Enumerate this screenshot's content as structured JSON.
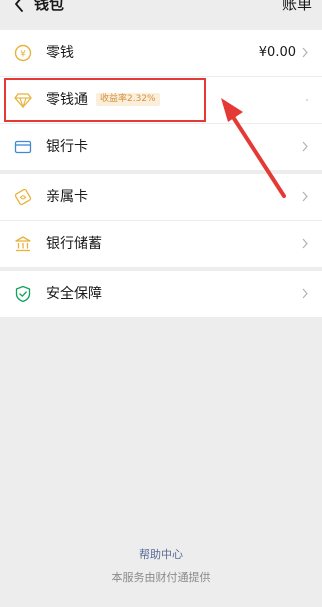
{
  "header": {
    "title": "钱包",
    "bill_label": "账单"
  },
  "groups": [
    {
      "rows": [
        {
          "label": "零钱",
          "value": "¥0.00",
          "icon": "coin-icon"
        },
        {
          "label": "零钱通",
          "badge": "收益率2.32%",
          "icon": "diamond-icon"
        },
        {
          "label": "银行卡",
          "icon": "bank-card-icon"
        }
      ]
    },
    {
      "rows": [
        {
          "label": "亲属卡",
          "icon": "family-card-icon"
        },
        {
          "label": "银行储蓄",
          "icon": "bank-savings-icon"
        }
      ]
    },
    {
      "rows": [
        {
          "label": "安全保障",
          "icon": "shield-icon"
        }
      ]
    }
  ],
  "footer": {
    "help_label": "帮助中心",
    "provider_note": "本服务由财付通提供"
  },
  "colors": {
    "accent_link": "#576b95",
    "badge_bg": "#fbeedb",
    "badge_text": "#d4933e",
    "annotation_red": "#e53935",
    "icon_gold": "#e8b23a",
    "icon_blue": "#3c8ad1",
    "icon_green": "#11a35e"
  }
}
